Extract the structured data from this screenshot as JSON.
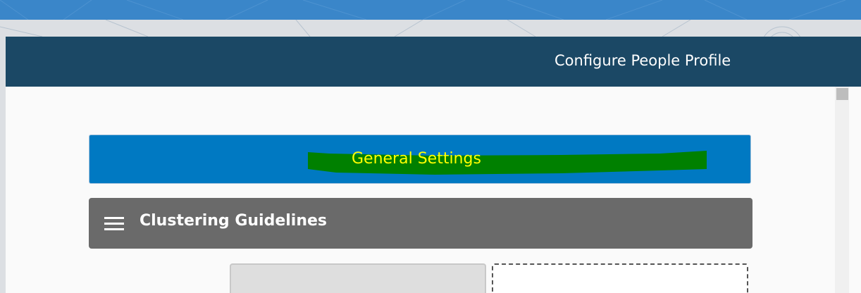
{
  "dialog": {
    "title": "Configure People Profile"
  },
  "sections": {
    "general_settings_label": "General Settings",
    "clustering_guidelines_label": "Clustering Guidelines"
  },
  "colors": {
    "header_bg": "#1b4865",
    "general_settings_bg": "#0079c2",
    "general_settings_text": "#ffff00",
    "highlight": "#008000",
    "clustering_bg": "#6a6a6a"
  },
  "icons": {
    "clustering_menu": "hamburger-menu-icon"
  }
}
